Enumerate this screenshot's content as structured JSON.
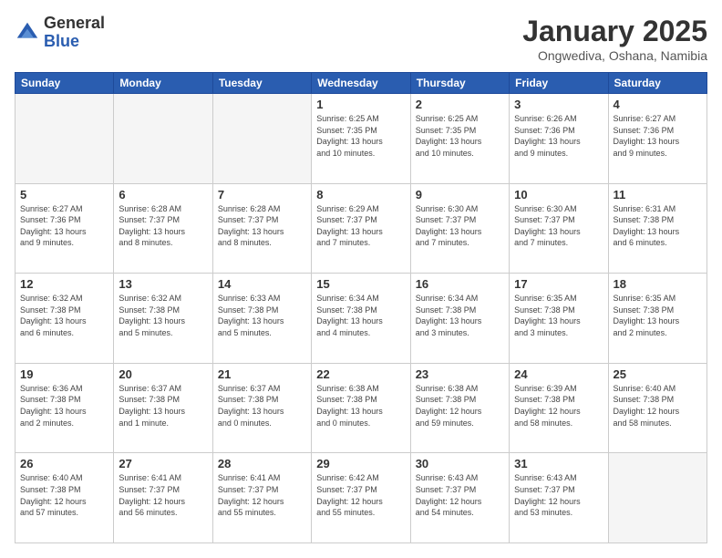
{
  "logo": {
    "general": "General",
    "blue": "Blue"
  },
  "title": "January 2025",
  "subtitle": "Ongwediva, Oshana, Namibia",
  "days_of_week": [
    "Sunday",
    "Monday",
    "Tuesday",
    "Wednesday",
    "Thursday",
    "Friday",
    "Saturday"
  ],
  "weeks": [
    [
      {
        "day": "",
        "info": ""
      },
      {
        "day": "",
        "info": ""
      },
      {
        "day": "",
        "info": ""
      },
      {
        "day": "1",
        "info": "Sunrise: 6:25 AM\nSunset: 7:35 PM\nDaylight: 13 hours\nand 10 minutes."
      },
      {
        "day": "2",
        "info": "Sunrise: 6:25 AM\nSunset: 7:35 PM\nDaylight: 13 hours\nand 10 minutes."
      },
      {
        "day": "3",
        "info": "Sunrise: 6:26 AM\nSunset: 7:36 PM\nDaylight: 13 hours\nand 9 minutes."
      },
      {
        "day": "4",
        "info": "Sunrise: 6:27 AM\nSunset: 7:36 PM\nDaylight: 13 hours\nand 9 minutes."
      }
    ],
    [
      {
        "day": "5",
        "info": "Sunrise: 6:27 AM\nSunset: 7:36 PM\nDaylight: 13 hours\nand 9 minutes."
      },
      {
        "day": "6",
        "info": "Sunrise: 6:28 AM\nSunset: 7:37 PM\nDaylight: 13 hours\nand 8 minutes."
      },
      {
        "day": "7",
        "info": "Sunrise: 6:28 AM\nSunset: 7:37 PM\nDaylight: 13 hours\nand 8 minutes."
      },
      {
        "day": "8",
        "info": "Sunrise: 6:29 AM\nSunset: 7:37 PM\nDaylight: 13 hours\nand 7 minutes."
      },
      {
        "day": "9",
        "info": "Sunrise: 6:30 AM\nSunset: 7:37 PM\nDaylight: 13 hours\nand 7 minutes."
      },
      {
        "day": "10",
        "info": "Sunrise: 6:30 AM\nSunset: 7:37 PM\nDaylight: 13 hours\nand 7 minutes."
      },
      {
        "day": "11",
        "info": "Sunrise: 6:31 AM\nSunset: 7:38 PM\nDaylight: 13 hours\nand 6 minutes."
      }
    ],
    [
      {
        "day": "12",
        "info": "Sunrise: 6:32 AM\nSunset: 7:38 PM\nDaylight: 13 hours\nand 6 minutes."
      },
      {
        "day": "13",
        "info": "Sunrise: 6:32 AM\nSunset: 7:38 PM\nDaylight: 13 hours\nand 5 minutes."
      },
      {
        "day": "14",
        "info": "Sunrise: 6:33 AM\nSunset: 7:38 PM\nDaylight: 13 hours\nand 5 minutes."
      },
      {
        "day": "15",
        "info": "Sunrise: 6:34 AM\nSunset: 7:38 PM\nDaylight: 13 hours\nand 4 minutes."
      },
      {
        "day": "16",
        "info": "Sunrise: 6:34 AM\nSunset: 7:38 PM\nDaylight: 13 hours\nand 3 minutes."
      },
      {
        "day": "17",
        "info": "Sunrise: 6:35 AM\nSunset: 7:38 PM\nDaylight: 13 hours\nand 3 minutes."
      },
      {
        "day": "18",
        "info": "Sunrise: 6:35 AM\nSunset: 7:38 PM\nDaylight: 13 hours\nand 2 minutes."
      }
    ],
    [
      {
        "day": "19",
        "info": "Sunrise: 6:36 AM\nSunset: 7:38 PM\nDaylight: 13 hours\nand 2 minutes."
      },
      {
        "day": "20",
        "info": "Sunrise: 6:37 AM\nSunset: 7:38 PM\nDaylight: 13 hours\nand 1 minute."
      },
      {
        "day": "21",
        "info": "Sunrise: 6:37 AM\nSunset: 7:38 PM\nDaylight: 13 hours\nand 0 minutes."
      },
      {
        "day": "22",
        "info": "Sunrise: 6:38 AM\nSunset: 7:38 PM\nDaylight: 13 hours\nand 0 minutes."
      },
      {
        "day": "23",
        "info": "Sunrise: 6:38 AM\nSunset: 7:38 PM\nDaylight: 12 hours\nand 59 minutes."
      },
      {
        "day": "24",
        "info": "Sunrise: 6:39 AM\nSunset: 7:38 PM\nDaylight: 12 hours\nand 58 minutes."
      },
      {
        "day": "25",
        "info": "Sunrise: 6:40 AM\nSunset: 7:38 PM\nDaylight: 12 hours\nand 58 minutes."
      }
    ],
    [
      {
        "day": "26",
        "info": "Sunrise: 6:40 AM\nSunset: 7:38 PM\nDaylight: 12 hours\nand 57 minutes."
      },
      {
        "day": "27",
        "info": "Sunrise: 6:41 AM\nSunset: 7:37 PM\nDaylight: 12 hours\nand 56 minutes."
      },
      {
        "day": "28",
        "info": "Sunrise: 6:41 AM\nSunset: 7:37 PM\nDaylight: 12 hours\nand 55 minutes."
      },
      {
        "day": "29",
        "info": "Sunrise: 6:42 AM\nSunset: 7:37 PM\nDaylight: 12 hours\nand 55 minutes."
      },
      {
        "day": "30",
        "info": "Sunrise: 6:43 AM\nSunset: 7:37 PM\nDaylight: 12 hours\nand 54 minutes."
      },
      {
        "day": "31",
        "info": "Sunrise: 6:43 AM\nSunset: 7:37 PM\nDaylight: 12 hours\nand 53 minutes."
      },
      {
        "day": "",
        "info": ""
      }
    ]
  ]
}
